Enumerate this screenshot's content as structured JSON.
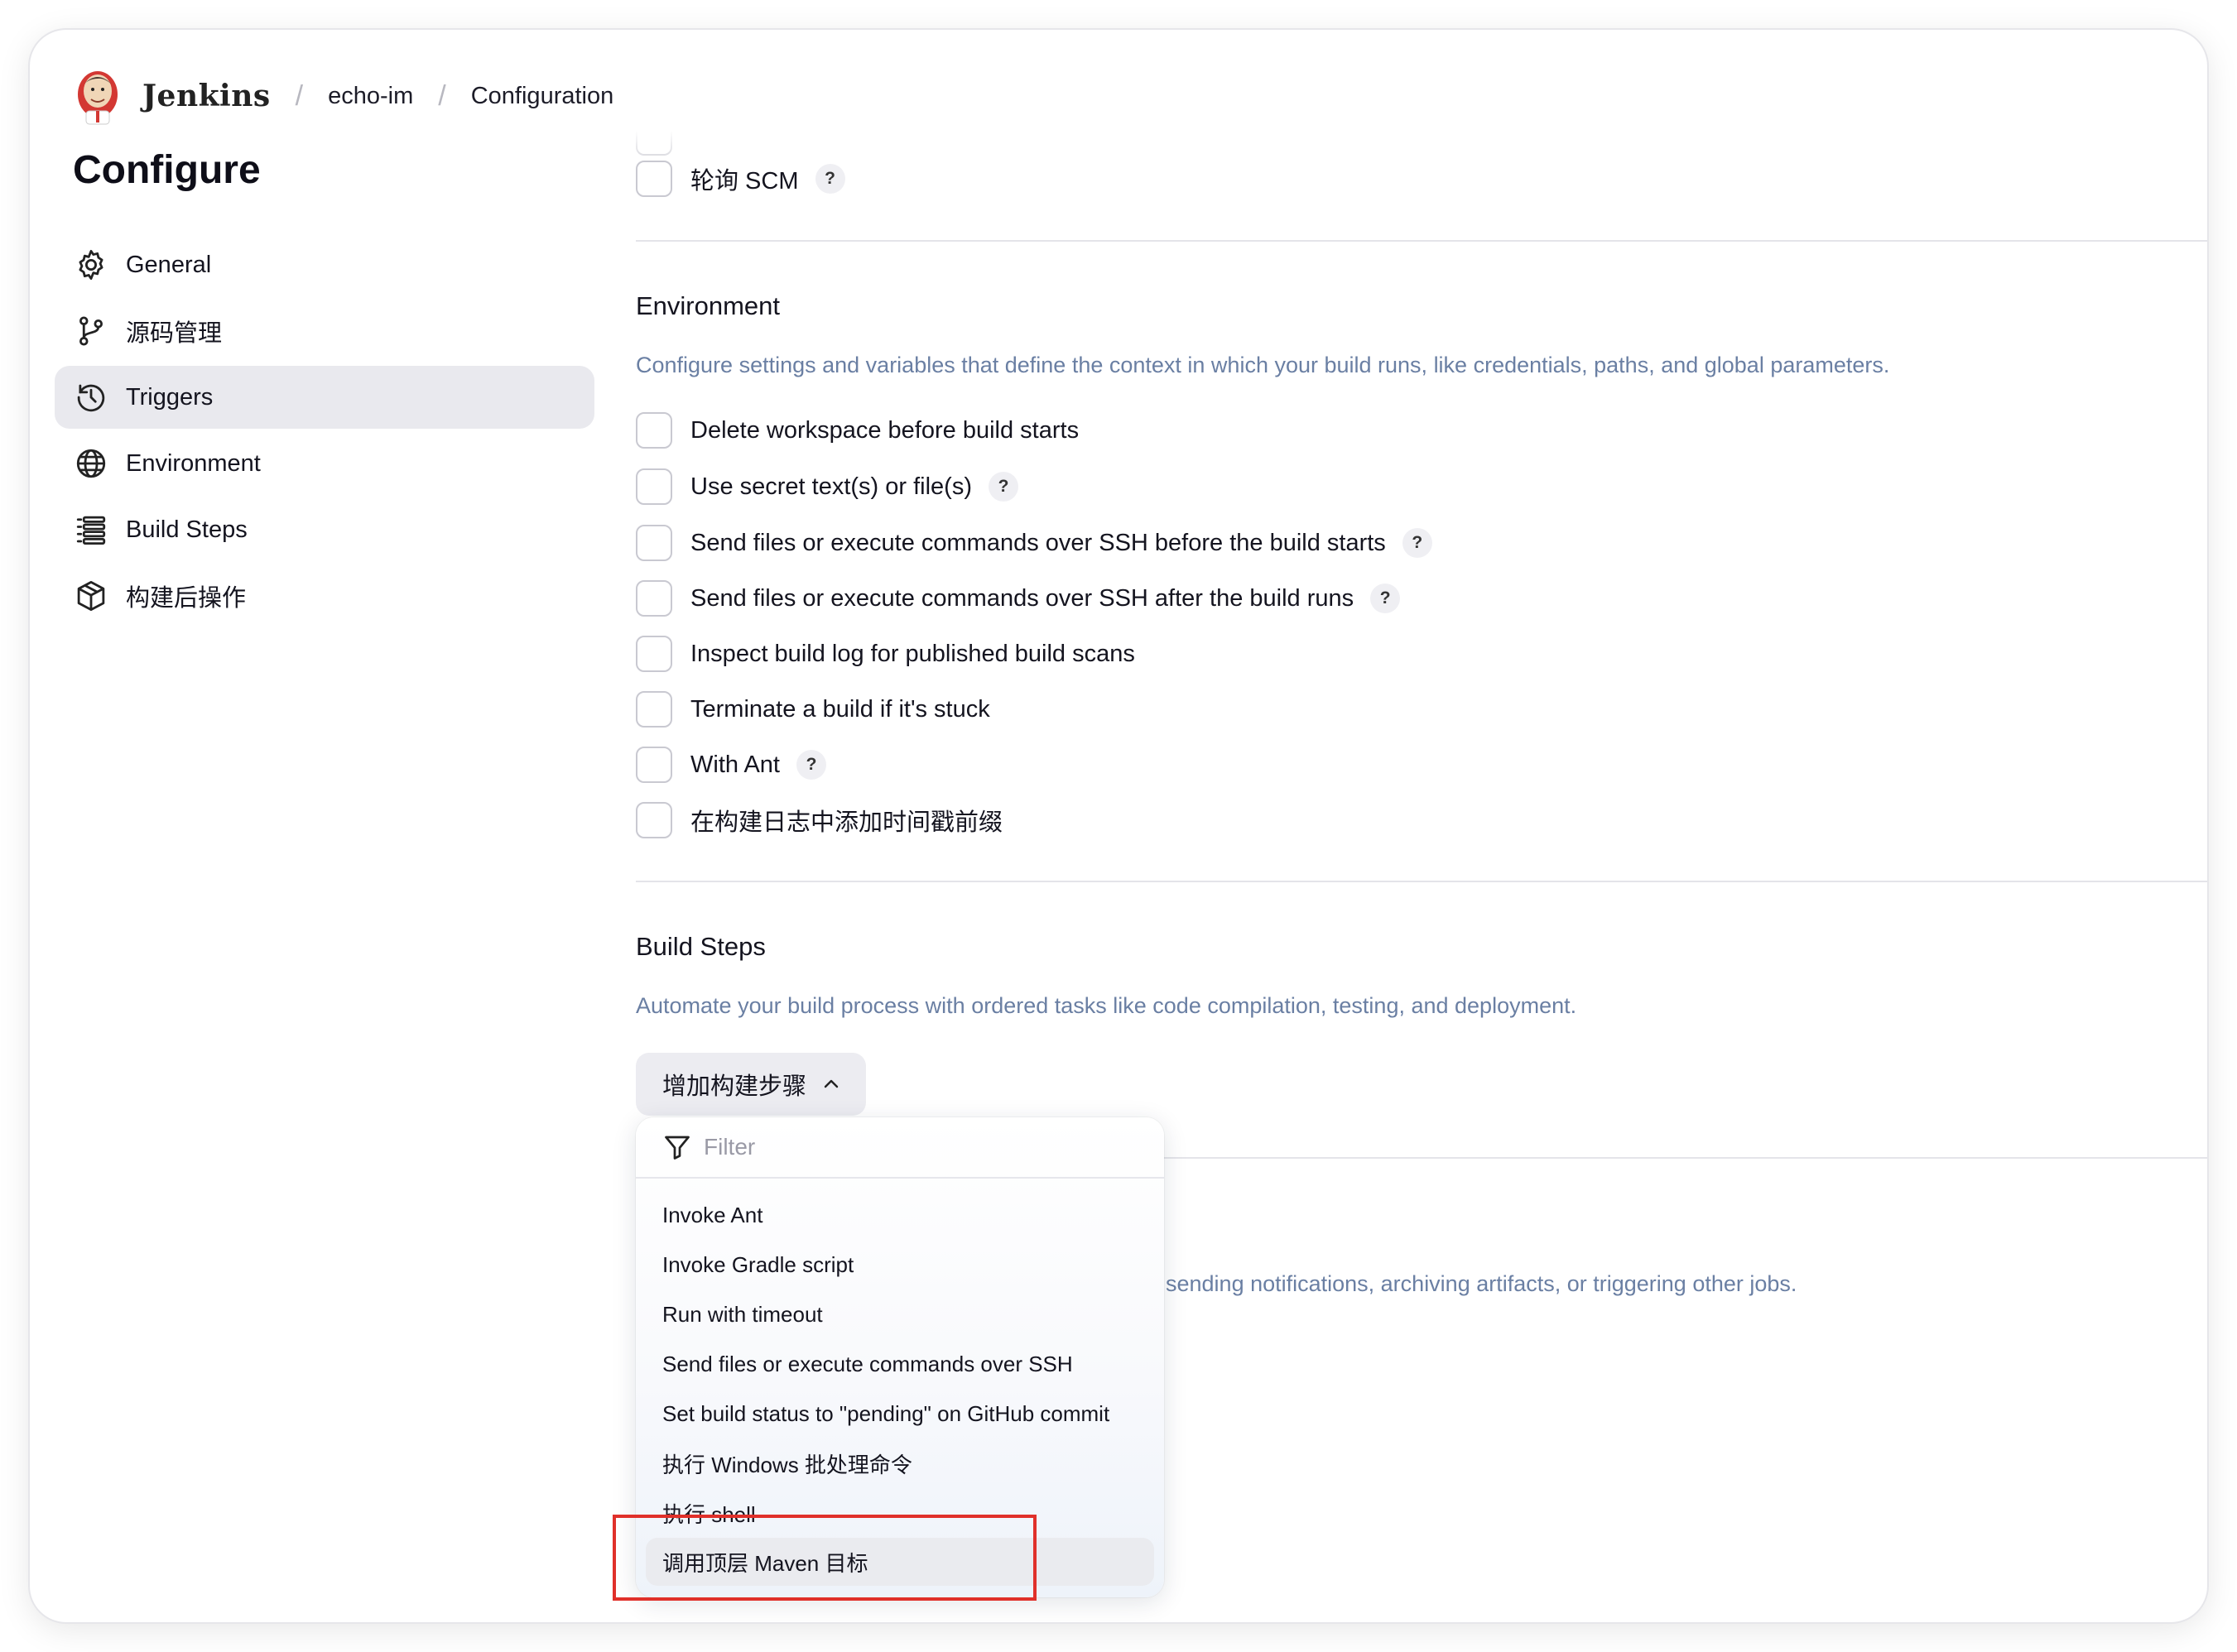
{
  "header": {
    "brand": "Jenkins",
    "breadcrumbs": [
      "echo-im",
      "Configuration"
    ]
  },
  "page_title": "Configure",
  "sidebar": {
    "items": [
      {
        "label": "General",
        "icon": "gear-icon"
      },
      {
        "label": "源码管理",
        "icon": "branch-icon"
      },
      {
        "label": "Triggers",
        "icon": "clock-icon",
        "active": true
      },
      {
        "label": "Environment",
        "icon": "globe-icon"
      },
      {
        "label": "Build Steps",
        "icon": "list-icon"
      },
      {
        "label": "构建后操作",
        "icon": "package-icon"
      }
    ]
  },
  "triggers": {
    "poll_scm_label": "轮询 SCM"
  },
  "environment": {
    "title": "Environment",
    "description": "Configure settings and variables that define the context in which your build runs, like credentials, paths, and global parameters.",
    "options": [
      {
        "label": "Delete workspace before build starts",
        "help": false
      },
      {
        "label": "Use secret text(s) or file(s)",
        "help": true
      },
      {
        "label": "Send files or execute commands over SSH before the build starts",
        "help": true
      },
      {
        "label": "Send files or execute commands over SSH after the build runs",
        "help": true
      },
      {
        "label": "Inspect build log for published build scans",
        "help": false
      },
      {
        "label": "Terminate a build if it's stuck",
        "help": false
      },
      {
        "label": "With Ant",
        "help": true
      },
      {
        "label": "在构建日志中添加时间戳前缀",
        "help": false
      }
    ]
  },
  "build_steps": {
    "title": "Build Steps",
    "description": "Automate your build process with ordered tasks like code compilation, testing, and deployment.",
    "add_button_label": "增加构建步骤"
  },
  "post_build": {
    "description_visible": "sending notifications, archiving artifacts, or triggering other jobs."
  },
  "dropdown": {
    "filter_placeholder": "Filter",
    "items": [
      "Invoke Ant",
      "Invoke Gradle script",
      "Run with timeout",
      "Send files or execute commands over SSH",
      "Set build status to \"pending\" on GitHub commit",
      "执行 Windows 批处理命令",
      "执行 shell",
      "调用顶层 Maven 目标"
    ],
    "highlighted": "调用顶层 Maven 目标"
  },
  "help_glyph": "?",
  "colors": {
    "accent_desc": "#6a7fa3",
    "active_nav_bg": "#e9e9ee",
    "annotation_red": "#e0302a"
  }
}
